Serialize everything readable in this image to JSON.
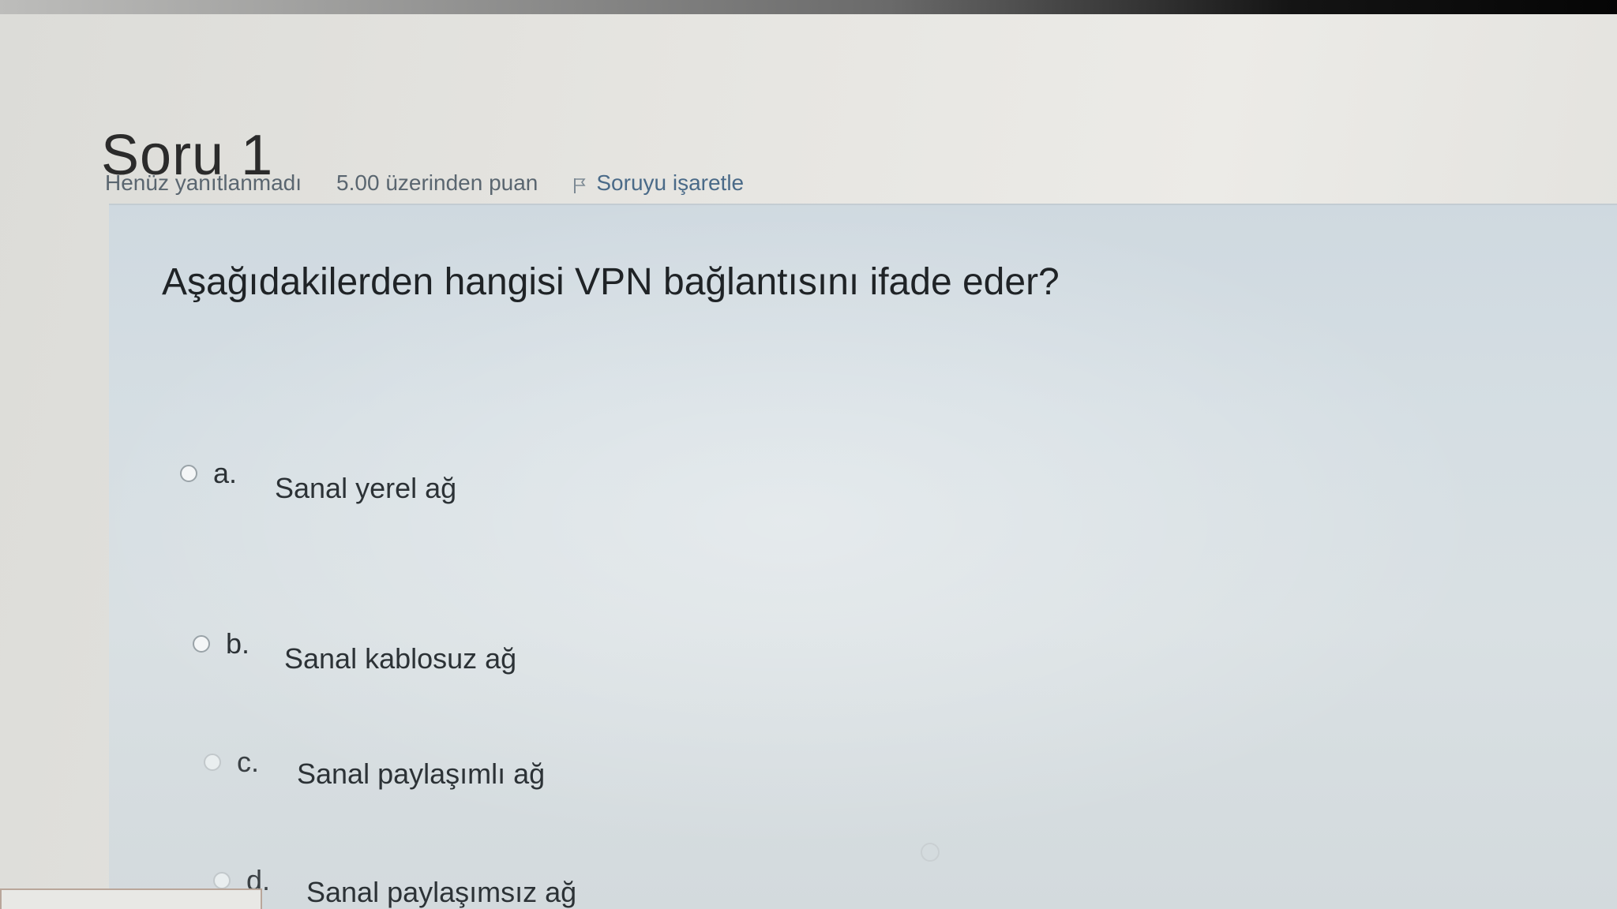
{
  "question": {
    "heading": "Soru 1",
    "status": "Henüz yanıtlanmadı",
    "grade": "5.00 üzerinden puan",
    "flag_label": "Soruyu işaretle",
    "flag_icon": "flag-icon",
    "text": "Aşağıdakilerden hangisi VPN bağlantısını ifade eder?"
  },
  "answers": [
    {
      "letter": "a.",
      "text": "Sanal yerel ağ",
      "selected": false
    },
    {
      "letter": "b.",
      "text": "Sanal kablosuz ağ",
      "selected": false
    },
    {
      "letter": "c.",
      "text": "Sanal paylaşımlı ağ",
      "selected": false
    },
    {
      "letter": "d.",
      "text": "Sanal paylaşımsız ağ",
      "selected": false
    }
  ],
  "colors": {
    "panel_background": "#d5dee3",
    "link": "#4a6a88",
    "heading": "#2b2b2b"
  }
}
